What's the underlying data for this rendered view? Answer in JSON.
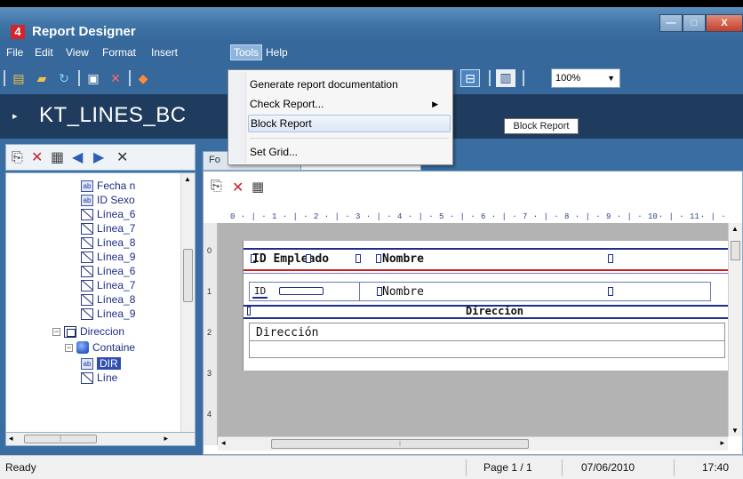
{
  "window": {
    "title": "Report Designer",
    "app_icon": "4",
    "controls": {
      "minimize": "—",
      "maximize": "□",
      "close": "X"
    }
  },
  "menubar": {
    "items": [
      "File",
      "Edit",
      "View",
      "Format",
      "Insert",
      "Tools",
      "Help"
    ],
    "active": "Tools"
  },
  "toolbar": {
    "zoom": "100%"
  },
  "header": {
    "report_name": "KT_LINES_BC"
  },
  "tooltip": "Block Report",
  "tools_menu": {
    "items": [
      {
        "label": "Generate report documentation"
      },
      {
        "label": "Check Report...",
        "submenu": true
      },
      {
        "label": "Block Report",
        "highlighted": true
      },
      {
        "label": "Set Grid..."
      }
    ]
  },
  "tree": {
    "items": [
      {
        "label": "Fecha n",
        "icon": "field-icon"
      },
      {
        "label": "ID Sexo",
        "icon": "field-icon"
      },
      {
        "label": "Línea_6",
        "icon": "line-icon"
      },
      {
        "label": "Línea_7",
        "icon": "line-icon"
      },
      {
        "label": "Línea_8",
        "icon": "line-icon"
      },
      {
        "label": "Línea_9",
        "icon": "line-icon"
      },
      {
        "label": "Línea_6",
        "icon": "line-icon"
      },
      {
        "label": "Línea_7",
        "icon": "line-icon"
      },
      {
        "label": "Línea_8",
        "icon": "line-icon"
      },
      {
        "label": "Línea_9",
        "icon": "line-icon"
      },
      {
        "label": "Direccion",
        "icon": "section-icon"
      },
      {
        "label": "Containe",
        "icon": "container-icon"
      },
      {
        "label": "DIR",
        "icon": "field-icon",
        "selected": true
      },
      {
        "label": "Líne",
        "icon": "line-icon"
      }
    ]
  },
  "design": {
    "tabs": [
      "Fo",
      "..."
    ],
    "ruler_labels": [
      "0",
      "1",
      "2",
      "3",
      "4",
      "5",
      "6",
      "7",
      "8",
      "9",
      "10",
      "11"
    ],
    "vruler_labels": [
      "0",
      "1",
      "2",
      "3",
      "4"
    ],
    "header_fields": {
      "id": "ID Empleado",
      "name": "Nombre"
    },
    "detail_fields": {
      "id": "ID",
      "name": "Nombre"
    },
    "group_title": "Direccion",
    "group_field": "Dirección"
  },
  "statusbar": {
    "status": "Ready",
    "page": "Page 1 / 1",
    "date": "07/06/2010",
    "time": "17:40"
  }
}
